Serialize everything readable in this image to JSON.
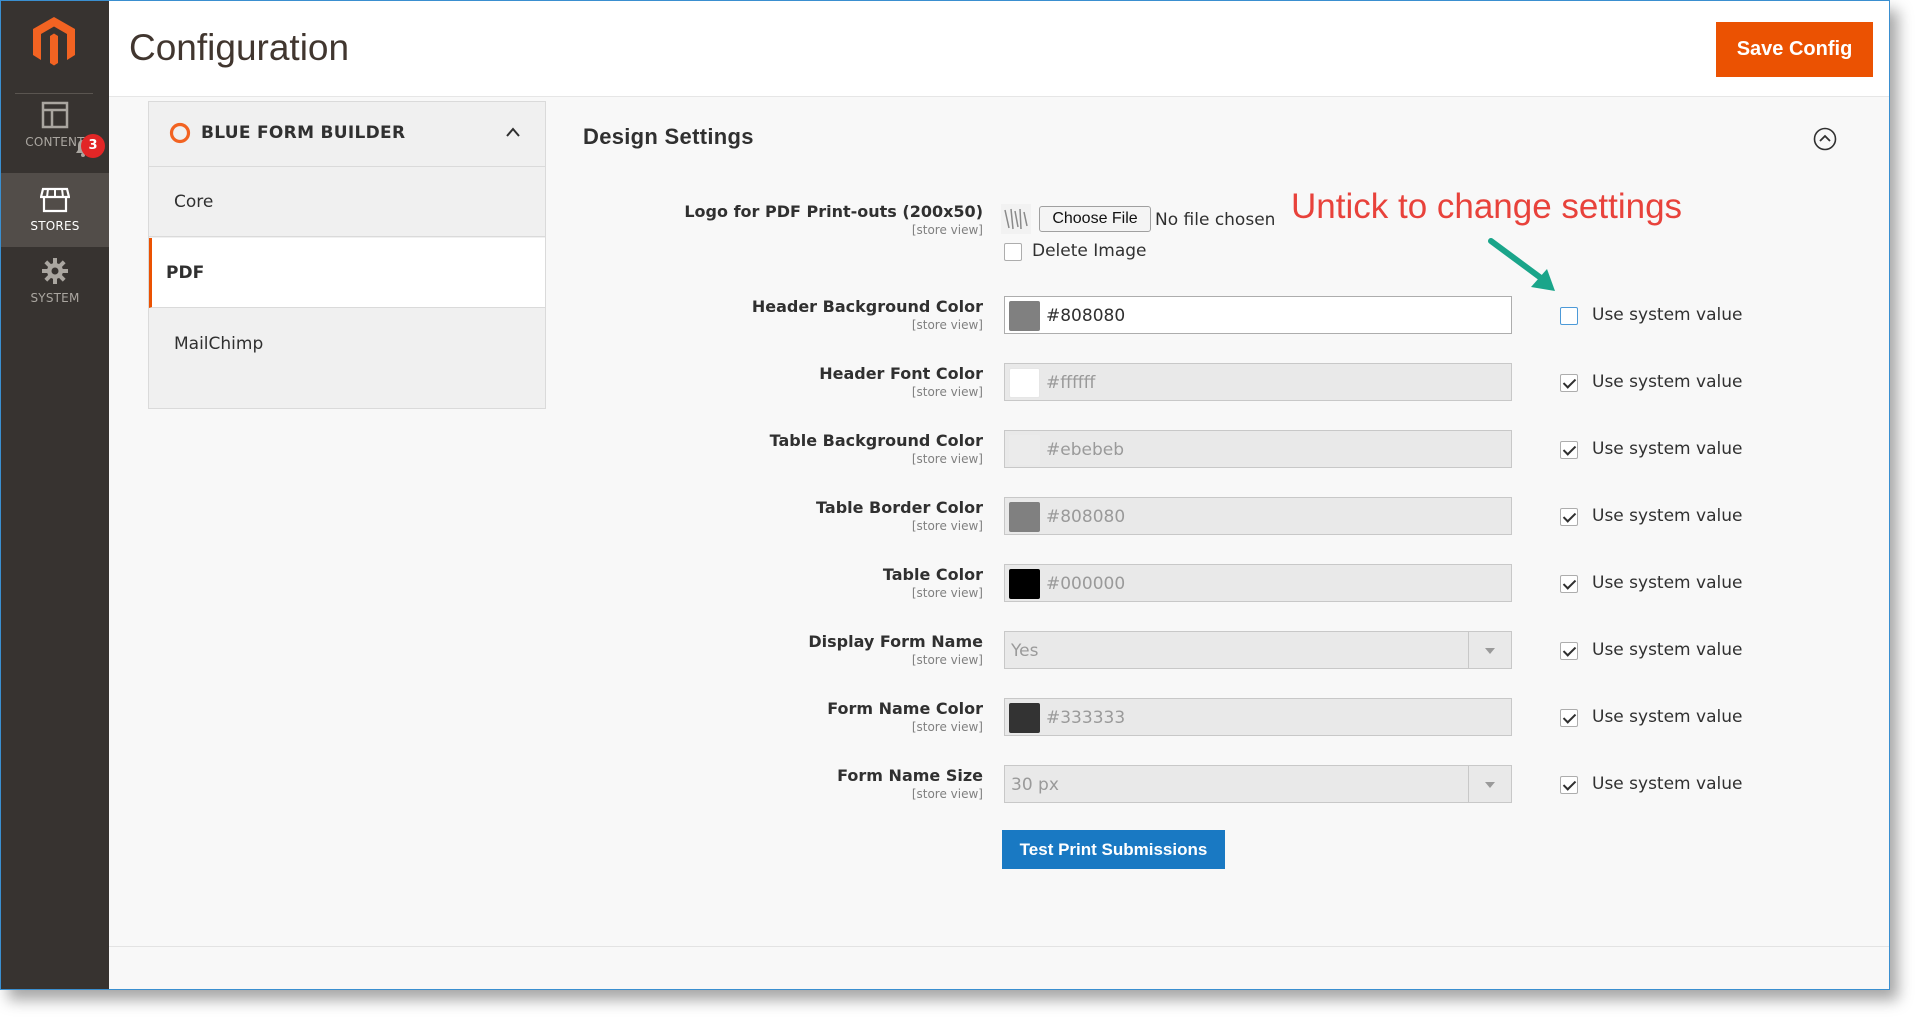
{
  "header": {
    "title": "Configuration",
    "save_label": "Save Config"
  },
  "sidebar": {
    "items": [
      {
        "label": "CONTENT",
        "icon": "layout-icon"
      },
      {
        "label": "STORES",
        "icon": "store-icon"
      },
      {
        "label": "SYSTEM",
        "icon": "gear-icon"
      }
    ],
    "notification_count": "3"
  },
  "tabs": {
    "section_title": "BLUE FORM BUILDER",
    "items": [
      {
        "label": "Core"
      },
      {
        "label": "PDF"
      },
      {
        "label": "MailChimp"
      }
    ]
  },
  "design": {
    "title": "Design Settings",
    "logo": {
      "label": "Logo for PDF Print-outs (200x50)",
      "scope": "[store view]",
      "choose_label": "Choose File",
      "no_file": "No file chosen",
      "delete_label": "Delete Image"
    },
    "annotation": "Untick to change settings",
    "use_system_label": "Use system value",
    "rows": [
      {
        "label": "Header Background Color",
        "scope": "[store view]",
        "value": "#808080",
        "swatch": "#808080",
        "use_system": false
      },
      {
        "label": "Header Font Color",
        "scope": "[store view]",
        "value": "#ffffff",
        "swatch": "#ffffff",
        "use_system": true
      },
      {
        "label": "Table Background Color",
        "scope": "[store view]",
        "value": "#ebebeb",
        "swatch": "#ebebeb",
        "use_system": true
      },
      {
        "label": "Table Border Color",
        "scope": "[store view]",
        "value": "#808080",
        "swatch": "#808080",
        "use_system": true
      },
      {
        "label": "Table Color",
        "scope": "[store view]",
        "value": "#000000",
        "swatch": "#000000",
        "use_system": true
      },
      {
        "label": "Display Form Name",
        "scope": "[store view]",
        "value": "Yes",
        "use_system": true
      },
      {
        "label": "Form Name Color",
        "scope": "[store view]",
        "value": "#333333",
        "swatch": "#333333",
        "use_system": true
      },
      {
        "label": "Form Name Size",
        "scope": "[store view]",
        "value": "30 px",
        "use_system": true
      }
    ],
    "test_button": "Test Print Submissions"
  },
  "colors": {
    "accent": "#eb5202",
    "primary_button": "#1979c3",
    "annotation": "#e8423b",
    "arrow": "#1aa58a"
  }
}
